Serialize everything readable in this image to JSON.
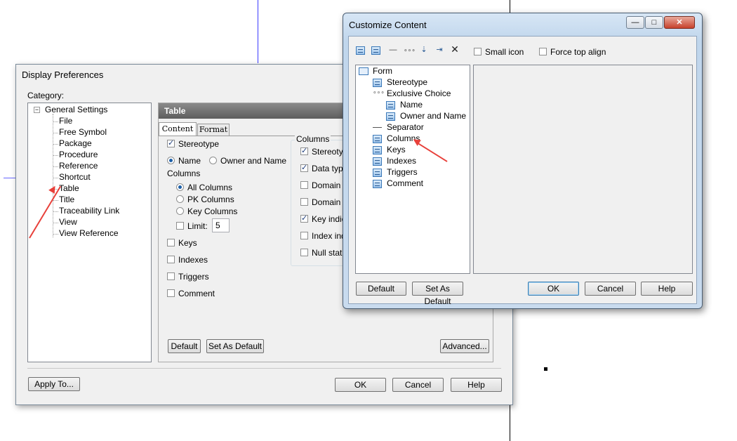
{
  "display_prefs": {
    "title": "Display Preferences",
    "category_label": "Category:",
    "tree_root": "General Settings",
    "tree_items": [
      "File",
      "Free Symbol",
      "Package",
      "Procedure",
      "Reference",
      "Shortcut",
      "Table",
      "Title",
      "Traceability Link",
      "View",
      "View Reference"
    ],
    "panel_header": "Table",
    "tabs": [
      "Content",
      "Format"
    ],
    "stereotype": "Stereotype",
    "name_radio": "Name",
    "owner_radio": "Owner and Name",
    "columns_label": "Columns",
    "all_columns": "All Columns",
    "pk_columns": "PK Columns",
    "key_columns": "Key Columns",
    "limit_label": "Limit:",
    "limit_value": "5",
    "keys": "Keys",
    "indexes": "Indexes",
    "triggers": "Triggers",
    "comment": "Comment",
    "columns_group": "Columns",
    "col_options": [
      "Stereotyp",
      "Data type",
      "Domain o",
      "Domain",
      "Key indica",
      "Index indi",
      "Null status"
    ],
    "default_btn": "Default",
    "set_default_btn": "Set As Default",
    "advanced_btn": "Advanced...",
    "apply_btn": "Apply To...",
    "ok_btn": "OK",
    "cancel_btn": "Cancel",
    "help_btn": "Help"
  },
  "customize": {
    "title": "Customize Content",
    "small_icon": "Small icon",
    "force_top_align": "Force top align",
    "tree_root": "Form",
    "tree_items": [
      "Stereotype",
      "Exclusive Choice",
      "Name",
      "Owner and Name",
      "Separator",
      "Columns",
      "Keys",
      "Indexes",
      "Triggers",
      "Comment"
    ],
    "default_btn": "Default",
    "set_default_btn": "Set As Default",
    "ok_btn": "OK",
    "cancel_btn": "Cancel",
    "help_btn": "Help"
  },
  "colors": {
    "arrow": "#e8403a",
    "panel_header": "#6e6e6e"
  }
}
